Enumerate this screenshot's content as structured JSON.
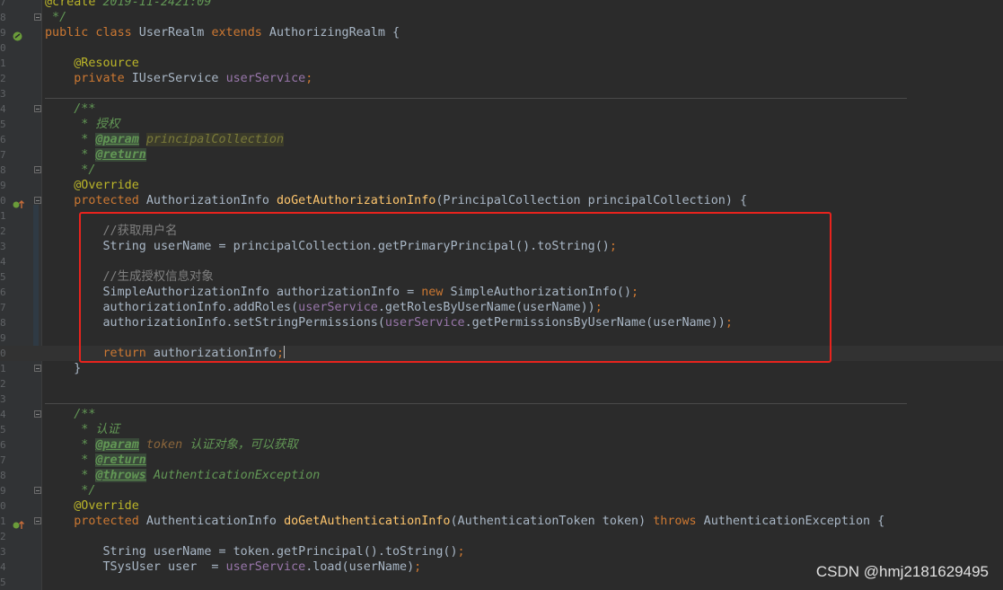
{
  "editor": {
    "lines": [
      {
        "num": "7",
        "html": "<span class=\"ann\">@create</span> <span class=\"cm\">2019-11-2421:09</span>"
      },
      {
        "num": "8",
        "html": "<span class=\"cm\"> */</span>"
      },
      {
        "num": "9",
        "html": "<span class=\"k\">public class</span> UserRealm <span class=\"k\">extends</span> AuthorizingRealm {"
      },
      {
        "num": "0",
        "html": ""
      },
      {
        "num": "1",
        "html": "    <span class=\"ann\">@Resource</span>"
      },
      {
        "num": "2",
        "html": "    <span class=\"k\">private</span> IUserService <span class=\"fld\">userService</span><span class=\"k\">;</span>"
      },
      {
        "num": "3",
        "html": ""
      },
      {
        "num": "4",
        "html": "    <span class=\"cm\">/**</span>"
      },
      {
        "num": "5",
        "html": "<span class=\"cm\">     * 授权</span>"
      },
      {
        "num": "6",
        "html": "<span class=\"cm\">     * </span><span class=\"tag\">@param</span> <span class=\"hlparam\">principalCollection</span>"
      },
      {
        "num": "7",
        "html": "<span class=\"cm\">     * </span><span class=\"tag\">@return</span>"
      },
      {
        "num": "8",
        "html": "<span class=\"cm\">     */</span>"
      },
      {
        "num": "9",
        "html": "    <span class=\"ann\">@Override</span>"
      },
      {
        "num": "0",
        "html": "    <span class=\"k\">protected</span> AuthorizationInfo <span class=\"fn\">doGetAuthorizationInfo</span>(PrincipalCollection principalCollection) {"
      },
      {
        "num": "1",
        "html": ""
      },
      {
        "num": "2",
        "html": "        <span class=\"ln-cm\">//获取用户名</span>"
      },
      {
        "num": "3",
        "html": "        String userName = principalCollection.getPrimaryPrincipal().toString()<span class=\"k\">;</span>"
      },
      {
        "num": "4",
        "html": ""
      },
      {
        "num": "5",
        "html": "        <span class=\"ln-cm\">//生成授权信息对象</span>"
      },
      {
        "num": "6",
        "html": "        SimpleAuthorizationInfo authorizationInfo = <span class=\"k\">new</span> SimpleAuthorizationInfo()<span class=\"k\">;</span>"
      },
      {
        "num": "7",
        "html": "        authorizationInfo.addRoles(<span class=\"fld\">userService</span>.getRolesByUserName(userName))<span class=\"k\">;</span>"
      },
      {
        "num": "8",
        "html": "        authorizationInfo.setStringPermissions(<span class=\"fld\">userService</span>.getPermissionsByUserName(userName))<span class=\"k\">;</span>"
      },
      {
        "num": "9",
        "html": ""
      },
      {
        "num": "0",
        "html": "        <span class=\"k\">return</span> authorizationInfo<span class=\"k\">;</span><span class=\"caret\"></span>"
      },
      {
        "num": "1",
        "html": "    }"
      },
      {
        "num": "2",
        "html": ""
      },
      {
        "num": "3",
        "html": ""
      },
      {
        "num": "4",
        "html": "    <span class=\"cm\">/**</span>"
      },
      {
        "num": "5",
        "html": "<span class=\"cm\">     * 认证</span>"
      },
      {
        "num": "6",
        "html": "<span class=\"cm\">     * </span><span class=\"tag\">@param</span> <span class=\"hl\">token</span> <span class=\"cm\">认证对象，可以获取</span>"
      },
      {
        "num": "7",
        "html": "<span class=\"cm\">     * </span><span class=\"tag\">@return</span>"
      },
      {
        "num": "8",
        "html": "<span class=\"cm\">     * </span><span class=\"tag\">@throws</span> <span class=\"cm\">AuthenticationException</span>"
      },
      {
        "num": "9",
        "html": "<span class=\"cm\">     */</span>"
      },
      {
        "num": "0",
        "html": "    <span class=\"ann\">@Override</span>"
      },
      {
        "num": "1",
        "html": "    <span class=\"k\">protected</span> AuthenticationInfo <span class=\"fn\">doGetAuthenticationInfo</span>(AuthenticationToken token) <span class=\"k\">throws</span> AuthenticationException {"
      },
      {
        "num": "2",
        "html": ""
      },
      {
        "num": "3",
        "html": "        String userName = token.getPrincipal().toString()<span class=\"k\">;</span>"
      },
      {
        "num": "4",
        "html": "        TSysUser user  = <span class=\"fld\">userService</span>.load(userName)<span class=\"k\">;</span>"
      },
      {
        "num": "5",
        "html": ""
      }
    ]
  },
  "watermark": "CSDN @hmj2181629495",
  "colors": {
    "highlight_box": "#e8231d",
    "background": "#2b2b2b"
  }
}
